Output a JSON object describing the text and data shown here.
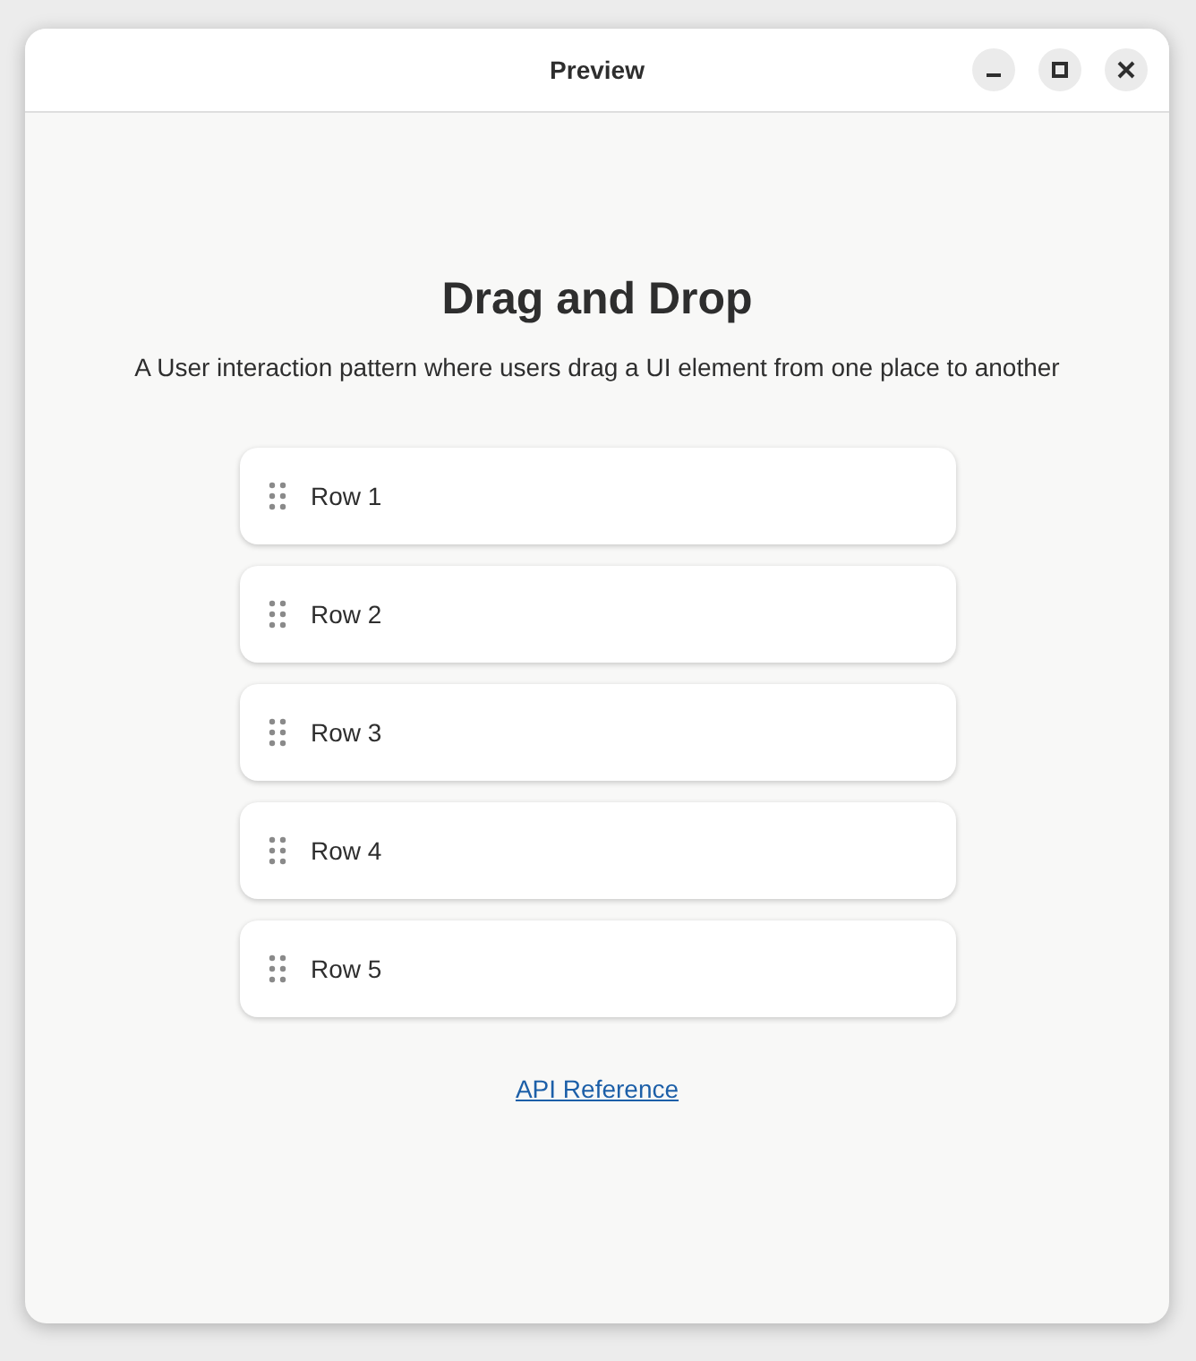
{
  "window": {
    "title": "Preview"
  },
  "heading": "Drag and Drop",
  "description": "A User interaction pattern where users drag a UI element from one place to another",
  "rows": [
    {
      "label": "Row 1"
    },
    {
      "label": "Row 2"
    },
    {
      "label": "Row 3"
    },
    {
      "label": "Row 4"
    },
    {
      "label": "Row 5"
    }
  ],
  "link": "API Reference"
}
